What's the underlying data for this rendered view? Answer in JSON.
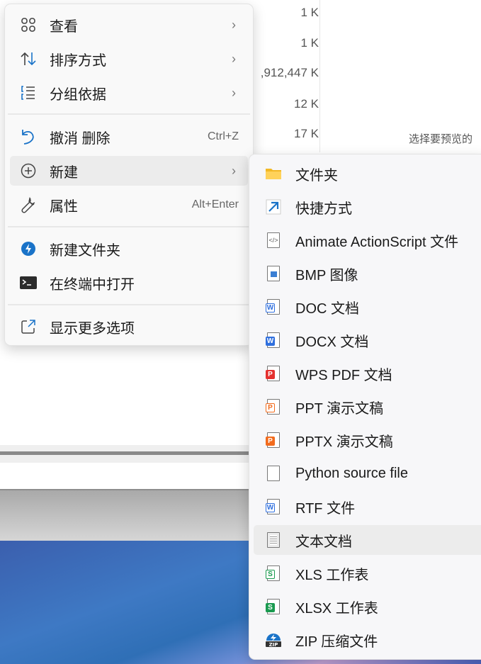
{
  "background": {
    "sizes": [
      "1 K",
      "1 K",
      ",912,447 K",
      "12 K",
      "17 K"
    ],
    "preview_text": "选择要预览的"
  },
  "main_menu": {
    "items": [
      {
        "label": "查看",
        "icon": "grid-icon",
        "submenu": true
      },
      {
        "label": "排序方式",
        "icon": "sort-icon",
        "submenu": true
      },
      {
        "label": "分组依据",
        "icon": "group-list-icon",
        "submenu": true
      },
      {
        "label": "撤消 删除",
        "icon": "undo-icon",
        "shortcut": "Ctrl+Z"
      },
      {
        "label": "新建",
        "icon": "plus-circle-icon",
        "submenu": true
      },
      {
        "label": "属性",
        "icon": "wrench-icon",
        "shortcut": "Alt+Enter"
      },
      {
        "label": "新建文件夹",
        "icon": "new-folder-bolt-icon"
      },
      {
        "label": "在终端中打开",
        "icon": "terminal-icon"
      },
      {
        "label": "显示更多选项",
        "icon": "more-options-icon"
      }
    ]
  },
  "new_submenu": {
    "items": [
      {
        "label": "文件夹",
        "icon": "folder-icon"
      },
      {
        "label": "快捷方式",
        "icon": "shortcut-arrow-icon"
      },
      {
        "label": "Animate ActionScript 文件",
        "icon": "actionscript-file-icon"
      },
      {
        "label": "BMP 图像",
        "icon": "bmp-image-icon"
      },
      {
        "label": "DOC 文档",
        "icon": "doc-file-icon"
      },
      {
        "label": "DOCX 文档",
        "icon": "docx-file-icon"
      },
      {
        "label": "WPS PDF 文档",
        "icon": "pdf-file-icon"
      },
      {
        "label": "PPT 演示文稿",
        "icon": "ppt-file-icon"
      },
      {
        "label": "PPTX 演示文稿",
        "icon": "pptx-file-icon"
      },
      {
        "label": "Python source file",
        "icon": "blank-file-icon"
      },
      {
        "label": "RTF 文件",
        "icon": "rtf-file-icon"
      },
      {
        "label": "文本文档",
        "icon": "text-file-icon"
      },
      {
        "label": "XLS 工作表",
        "icon": "xls-file-icon"
      },
      {
        "label": "XLSX 工作表",
        "icon": "xlsx-file-icon"
      },
      {
        "label": "ZIP 压缩文件",
        "icon": "zip-file-icon"
      }
    ],
    "highlighted": "文本文档"
  }
}
